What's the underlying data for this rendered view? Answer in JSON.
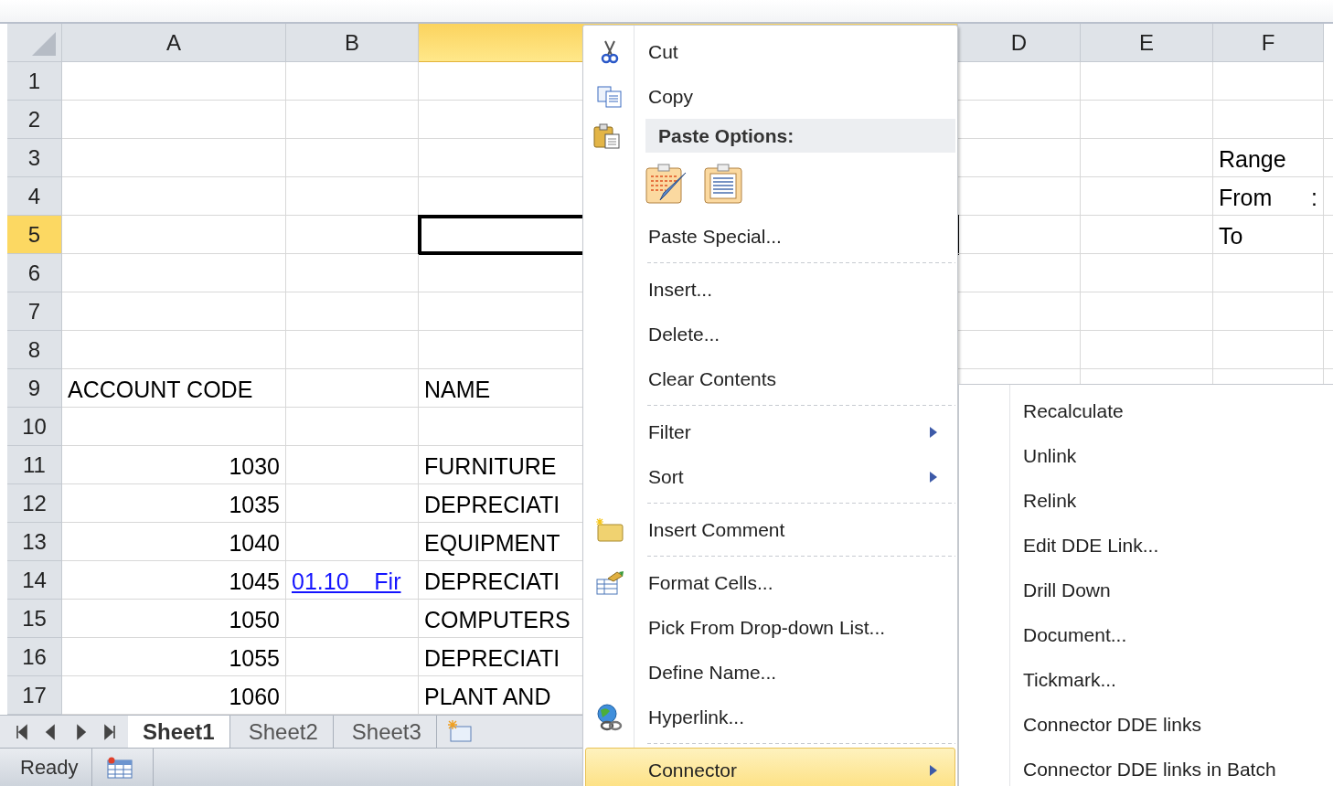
{
  "grid": {
    "columns": [
      {
        "label": "A",
        "selected": false
      },
      {
        "label": "B",
        "selected": false
      },
      {
        "selected": true
      },
      {
        "label": "D",
        "selected": false
      },
      {
        "label": "E",
        "selected": false
      },
      {
        "label": "F",
        "selected": false
      }
    ],
    "rows": [
      {
        "label": "1",
        "selected": false,
        "cells": {}
      },
      {
        "label": "2",
        "selected": false,
        "cells": {}
      },
      {
        "label": "3",
        "selected": false,
        "cells": {
          "f": {
            "text": "Range",
            "kind": "text"
          }
        }
      },
      {
        "label": "4",
        "selected": false,
        "cells": {
          "f": {
            "text": "From",
            "kind": "text",
            "suffix": ":"
          }
        }
      },
      {
        "label": "5",
        "selected": true,
        "cells": {
          "f": {
            "text": "To",
            "kind": "text"
          }
        }
      },
      {
        "label": "6",
        "selected": false,
        "cells": {}
      },
      {
        "label": "7",
        "selected": false,
        "cells": {}
      },
      {
        "label": "8",
        "selected": false,
        "cells": {}
      },
      {
        "label": "9",
        "selected": false,
        "cells": {
          "a": {
            "text": "ACCOUNT CODE",
            "kind": "text"
          },
          "c": {
            "text": "NAME",
            "kind": "text"
          }
        }
      },
      {
        "label": "10",
        "selected": false,
        "cells": {}
      },
      {
        "label": "11",
        "selected": false,
        "cells": {
          "a": {
            "text": "1030",
            "kind": "number"
          },
          "c": {
            "text": "FURNITURE",
            "kind": "text"
          }
        }
      },
      {
        "label": "12",
        "selected": false,
        "cells": {
          "a": {
            "text": "1035",
            "kind": "number"
          },
          "c": {
            "text": "DEPRECIATI",
            "kind": "text"
          }
        }
      },
      {
        "label": "13",
        "selected": false,
        "cells": {
          "a": {
            "text": "1040",
            "kind": "number"
          },
          "c": {
            "text": "EQUIPMENT",
            "kind": "text"
          }
        }
      },
      {
        "label": "14",
        "selected": false,
        "cells": {
          "a": {
            "text": "1045",
            "kind": "number"
          },
          "b": {
            "text": "01.10    Fir",
            "kind": "link"
          },
          "c": {
            "text": "DEPRECIATI",
            "kind": "text"
          }
        }
      },
      {
        "label": "15",
        "selected": false,
        "cells": {
          "a": {
            "text": "1050",
            "kind": "number"
          },
          "c": {
            "text": "COMPUTERS",
            "kind": "text"
          }
        }
      },
      {
        "label": "16",
        "selected": false,
        "cells": {
          "a": {
            "text": "1055",
            "kind": "number"
          },
          "c": {
            "text": "DEPRECIATI",
            "kind": "text"
          }
        }
      },
      {
        "label": "17",
        "selected": false,
        "cells": {
          "a": {
            "text": "1060",
            "kind": "number"
          },
          "c": {
            "text": "PLANT AND",
            "kind": "text"
          }
        }
      }
    ]
  },
  "sheet_tabs": [
    {
      "label": "Sheet1",
      "selected": true
    },
    {
      "label": "Sheet2",
      "selected": false
    },
    {
      "label": "Sheet3",
      "selected": false
    }
  ],
  "status_bar": {
    "text": "Ready"
  },
  "context_menu": {
    "items": [
      {
        "kind": "item",
        "label": "Cut",
        "submenu": false,
        "selected": false
      },
      {
        "kind": "item",
        "label": "Copy",
        "submenu": false,
        "selected": false
      },
      {
        "kind": "header",
        "label": "Paste Options:"
      },
      {
        "kind": "paste_icons"
      },
      {
        "kind": "item",
        "label": "Paste Special...",
        "submenu": false,
        "selected": false
      },
      {
        "kind": "separator"
      },
      {
        "kind": "item",
        "label": "Insert...",
        "submenu": false,
        "selected": false
      },
      {
        "kind": "item",
        "label": "Delete...",
        "submenu": false,
        "selected": false
      },
      {
        "kind": "item",
        "label": "Clear Contents",
        "submenu": false,
        "selected": false
      },
      {
        "kind": "separator"
      },
      {
        "kind": "item",
        "label": "Filter",
        "submenu": true,
        "selected": false
      },
      {
        "kind": "item",
        "label": "Sort",
        "submenu": true,
        "selected": false
      },
      {
        "kind": "separator"
      },
      {
        "kind": "item",
        "label": "Insert Comment",
        "submenu": false,
        "selected": false
      },
      {
        "kind": "separator"
      },
      {
        "kind": "item",
        "label": "Format Cells...",
        "submenu": false,
        "selected": false
      },
      {
        "kind": "item",
        "label": "Pick From Drop-down List...",
        "submenu": false,
        "selected": false
      },
      {
        "kind": "item",
        "label": "Define Name...",
        "submenu": false,
        "selected": false
      },
      {
        "kind": "item",
        "label": "Hyperlink...",
        "submenu": false,
        "selected": false
      },
      {
        "kind": "separator"
      },
      {
        "kind": "item",
        "label": "Connector",
        "submenu": true,
        "selected": true
      }
    ]
  },
  "submenu": {
    "items": [
      {
        "label": "Recalculate",
        "selected": false
      },
      {
        "label": "Unlink",
        "selected": false
      },
      {
        "label": "Relink",
        "selected": false
      },
      {
        "label": "Edit DDE Link...",
        "selected": false
      },
      {
        "label": "Drill Down",
        "selected": false
      },
      {
        "label": "Document...",
        "selected": false
      },
      {
        "label": "Tickmark...",
        "selected": false
      },
      {
        "label": "Connector DDE links",
        "selected": false
      },
      {
        "label": "Connector DDE links in Batch",
        "selected": false
      }
    ]
  }
}
